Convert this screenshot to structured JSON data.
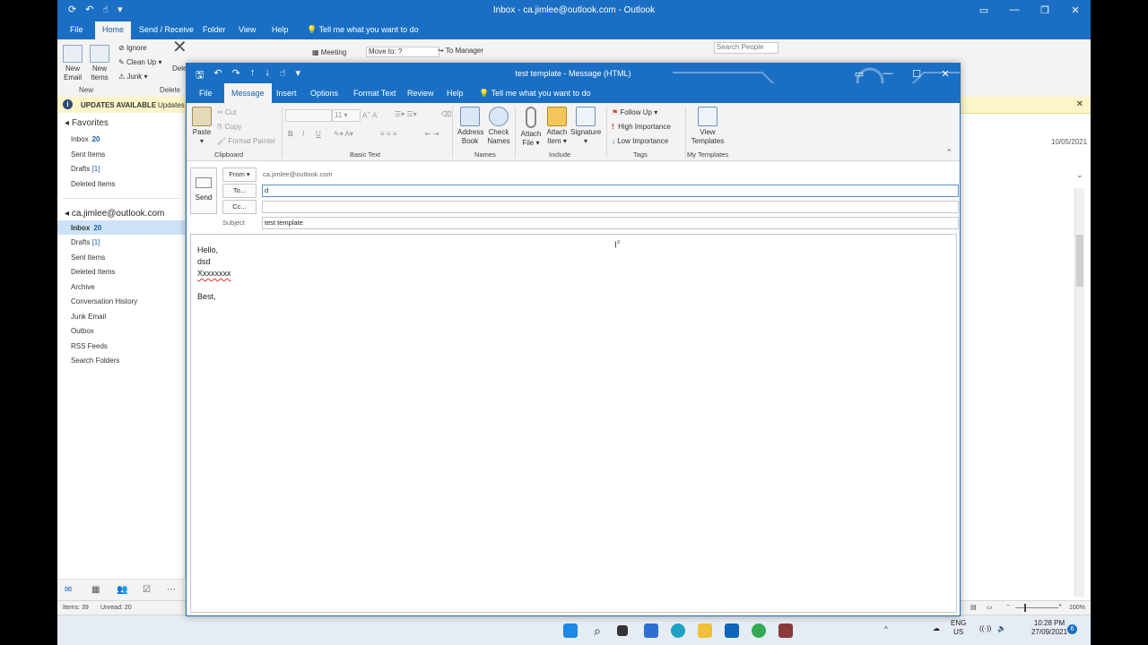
{
  "main": {
    "title": "Inbox - ca.jimlee@outlook.com - Outlook",
    "tabs": [
      "File",
      "Home",
      "Send / Receive",
      "Folder",
      "View",
      "Help"
    ],
    "active_tab": "Home",
    "tell_me": "Tell me what you want to do",
    "ribbon": {
      "new_email": "New Email",
      "new_items": "New Items",
      "group_new": "New",
      "ignore": "Ignore",
      "clean_up": "Clean Up",
      "junk": "Junk",
      "group_delete": "Delete",
      "delete_short": "Dele",
      "meeting": "Meeting",
      "move_to": "Move to: ?",
      "to_manager": "To Manager",
      "search_people": "Search People"
    },
    "updates": {
      "bold": "UPDATES AVAILABLE",
      "text": "Updates"
    },
    "folders": {
      "favorites_title": "Favorites",
      "favorites": [
        {
          "name": "Inbox",
          "count": "20"
        },
        {
          "name": "Sent Items",
          "count": ""
        },
        {
          "name": "Drafts",
          "count": "[1]"
        },
        {
          "name": "Deleted Items",
          "count": ""
        }
      ],
      "account": "ca.jimlee@outlook.com",
      "items": [
        {
          "name": "Inbox",
          "count": "20"
        },
        {
          "name": "Drafts",
          "count": "[1]"
        },
        {
          "name": "Sent Items",
          "count": ""
        },
        {
          "name": "Deleted Items",
          "count": ""
        },
        {
          "name": "Archive",
          "count": ""
        },
        {
          "name": "Conversation History",
          "count": ""
        },
        {
          "name": "Junk Email",
          "count": ""
        },
        {
          "name": "Outbox",
          "count": ""
        },
        {
          "name": "RSS Feeds",
          "count": ""
        },
        {
          "name": "Search Folders",
          "count": ""
        }
      ]
    },
    "date": "10/05/2021",
    "status": {
      "items": "Items: 39",
      "unread": "Unread: 20",
      "zoom": "100%"
    }
  },
  "compose": {
    "title": "test template  -  Message (HTML)",
    "tabs": [
      "File",
      "Message",
      "Insert",
      "Options",
      "Format Text",
      "Review",
      "Help"
    ],
    "active_tab": "Message",
    "tell_me": "Tell me what you want to do",
    "clipboard": {
      "paste": "Paste",
      "cut": "Cut",
      "copy": "Copy",
      "format_painter": "Format Painter",
      "label": "Clipboard"
    },
    "basic_text": {
      "font_size": "11",
      "label": "Basic Text"
    },
    "names": {
      "address_book_1": "Address",
      "address_book_2": "Book",
      "check_names_1": "Check",
      "check_names_2": "Names",
      "label": "Names"
    },
    "include": {
      "attach_file_1": "Attach",
      "attach_file_2": "File",
      "attach_item_1": "Attach",
      "attach_item_2": "Item",
      "signature": "Signature",
      "label": "Include"
    },
    "tags": {
      "follow_up": "Follow Up",
      "high": "High Importance",
      "low": "Low Importance",
      "label": "Tags"
    },
    "templates": {
      "view_1": "View",
      "view_2": "Templates",
      "label": "My Templates"
    },
    "send": "Send",
    "from_btn": "From",
    "from_value": "ca.jimlee@outlook.com",
    "to_btn": "To...",
    "to_value": "d",
    "cc_btn": "Cc...",
    "cc_value": "",
    "subject_label": "Subject",
    "subject_value": "test template",
    "body": {
      "l1": "Hello,",
      "l2": "dsd",
      "l3": "Xxxxxxxx",
      "l4": "Best,"
    }
  },
  "taskbar": {
    "lang1": "ENG",
    "lang2": "US",
    "time": "10:28 PM",
    "date": "27/09/2021",
    "badge": "6"
  },
  "colors": {
    "accent": "#1a6fc4",
    "selected": "#cde2f7",
    "updates_bg": "#fdf5c8"
  }
}
